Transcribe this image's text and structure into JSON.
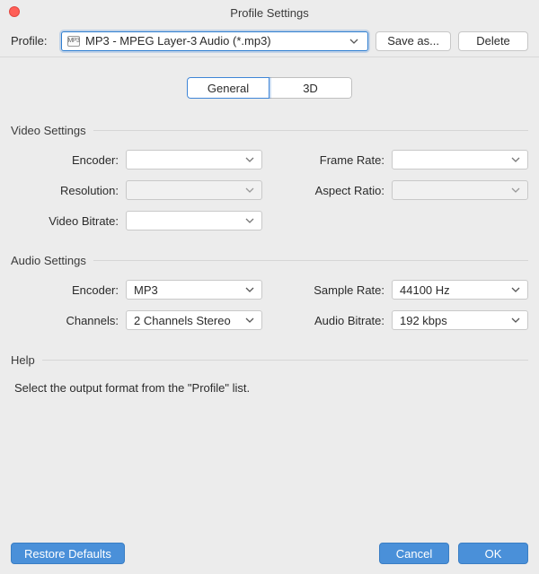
{
  "window": {
    "title": "Profile Settings"
  },
  "toolbar": {
    "profile_label": "Profile:",
    "profile_icon_text": "MP3",
    "profile_value": "MP3 - MPEG Layer-3 Audio (*.mp3)",
    "save_as_label": "Save as...",
    "delete_label": "Delete"
  },
  "tabs": {
    "general": "General",
    "three_d": "3D",
    "active": "general"
  },
  "video": {
    "title": "Video Settings",
    "encoder_label": "Encoder:",
    "encoder_value": "",
    "resolution_label": "Resolution:",
    "resolution_value": "",
    "bitrate_label": "Video Bitrate:",
    "bitrate_value": "",
    "framerate_label": "Frame Rate:",
    "framerate_value": "",
    "aspect_label": "Aspect Ratio:",
    "aspect_value": ""
  },
  "audio": {
    "title": "Audio Settings",
    "encoder_label": "Encoder:",
    "encoder_value": "MP3",
    "channels_label": "Channels:",
    "channels_value": "2 Channels Stereo",
    "samplerate_label": "Sample Rate:",
    "samplerate_value": "44100 Hz",
    "bitrate_label": "Audio Bitrate:",
    "bitrate_value": "192 kbps"
  },
  "help": {
    "title": "Help",
    "text": "Select the output format from the \"Profile\" list."
  },
  "buttons": {
    "restore": "Restore Defaults",
    "cancel": "Cancel",
    "ok": "OK"
  }
}
